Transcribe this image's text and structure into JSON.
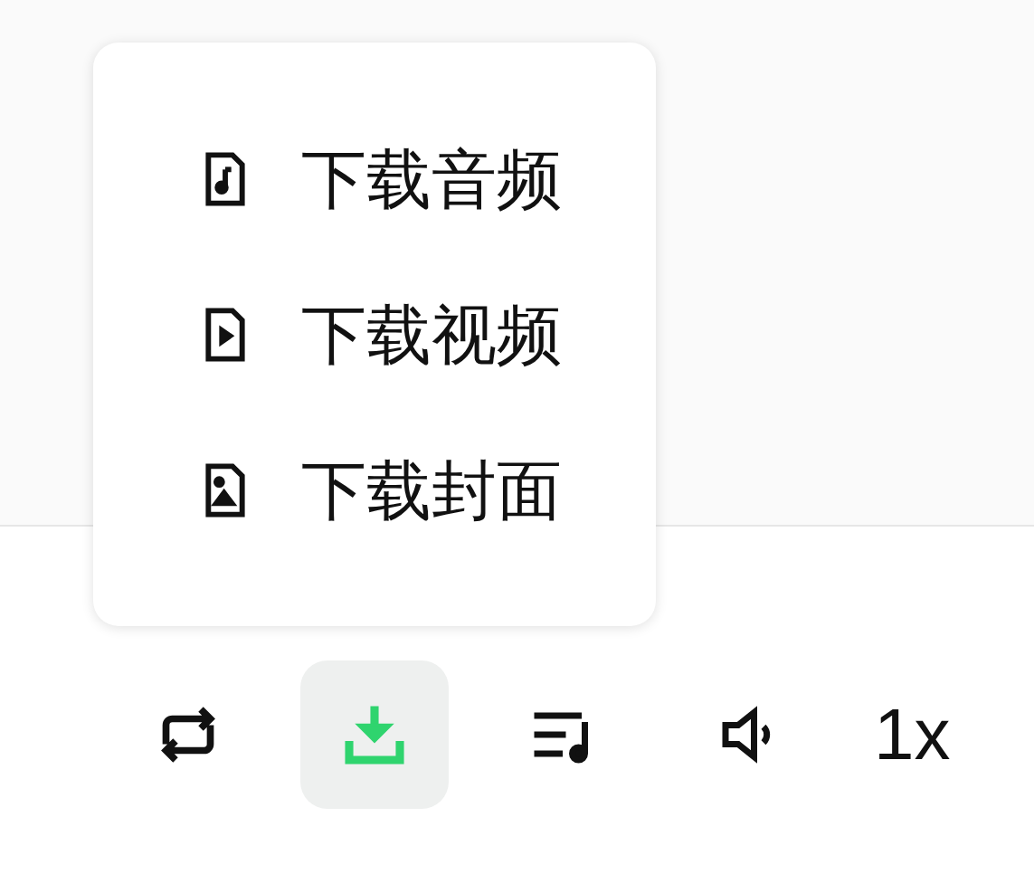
{
  "download_menu": {
    "items": [
      {
        "kind": "audio",
        "label": "下载音频"
      },
      {
        "kind": "video",
        "label": "下载视频"
      },
      {
        "kind": "cover",
        "label": "下载封面"
      }
    ]
  },
  "player_controls": [
    {
      "kind": "repeat",
      "selected": false
    },
    {
      "kind": "download",
      "selected": true
    },
    {
      "kind": "playlist",
      "selected": false
    },
    {
      "kind": "volume",
      "selected": false
    },
    {
      "kind": "speed",
      "label": "1x",
      "selected": false
    }
  ]
}
